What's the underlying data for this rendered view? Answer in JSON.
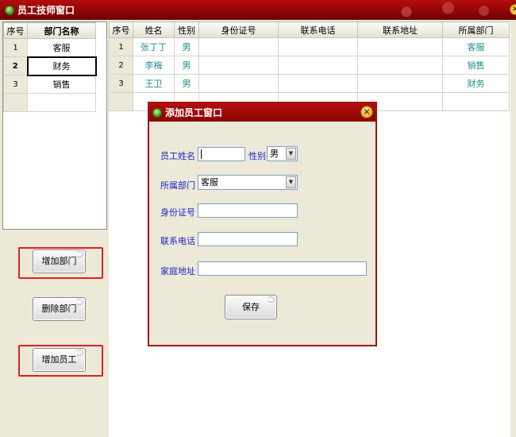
{
  "window": {
    "title": "员工技师窗口",
    "close_glyph": "×"
  },
  "departments": {
    "headers": [
      "序号",
      "部门名称"
    ],
    "rows": [
      {
        "index": "1",
        "name": "客服"
      },
      {
        "index": "2",
        "name": "财务"
      },
      {
        "index": "3",
        "name": "销售"
      }
    ],
    "selected_index": "2"
  },
  "buttons": {
    "add_department": "增加部门",
    "delete_department": "删除部门",
    "add_employee": "增加员工"
  },
  "employees": {
    "headers": [
      "序号",
      "姓名",
      "性别",
      "身份证号",
      "联系电话",
      "联系地址",
      "所属部门"
    ],
    "rows": [
      {
        "index": "1",
        "name": "张丁丁",
        "gender": "男",
        "id_number": "",
        "phone": "",
        "address": "",
        "department": "客服"
      },
      {
        "index": "2",
        "name": "李梅",
        "gender": "男",
        "id_number": "",
        "phone": "",
        "address": "",
        "department": "销售"
      },
      {
        "index": "3",
        "name": "王卫",
        "gender": "男",
        "id_number": "",
        "phone": "",
        "address": "",
        "department": "财务"
      }
    ]
  },
  "dialog": {
    "title": "添加员工窗口",
    "close_glyph": "×",
    "labels": {
      "name": "员工姓名",
      "gender": "性别",
      "department": "所属部门",
      "id_number": "身份证号",
      "phone": "联系电话",
      "address": "家庭地址"
    },
    "values": {
      "name": "",
      "gender": "男",
      "department": "客服",
      "id_number": "",
      "phone": "",
      "address": ""
    },
    "save_button": "保存"
  },
  "colors": {
    "title_bar": "#8c0505",
    "label_blue": "#2323c8",
    "link_teal": "#1f8c8c",
    "highlight_red": "#e02020"
  }
}
